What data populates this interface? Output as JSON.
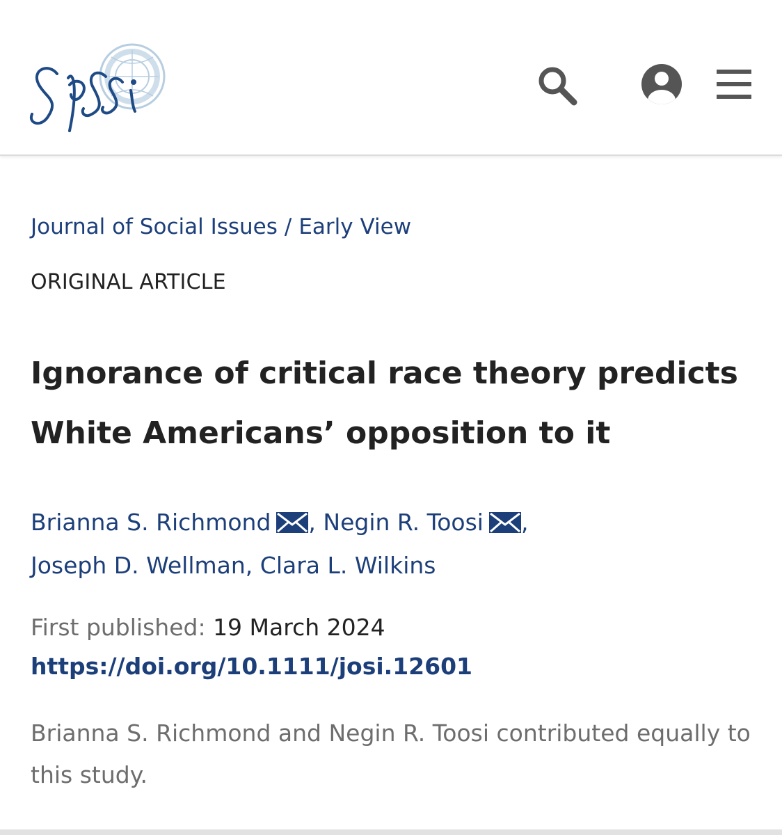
{
  "header": {
    "logo_text": "SPSSI",
    "icons": {
      "search": "search-icon",
      "account": "account-icon",
      "menu": "menu-icon"
    }
  },
  "breadcrumb": {
    "journal": "Journal of Social Issues",
    "separator": "/",
    "section": "Early View"
  },
  "article_type": "ORIGINAL ARTICLE",
  "title": "Ignorance of critical race theory predicts White Americans’ opposition to it",
  "authors": [
    {
      "name": "Brianna S. Richmond",
      "has_email": true
    },
    {
      "name": "Negin R. Toosi",
      "has_email": true
    },
    {
      "name": "Joseph D. Wellman",
      "has_email": false
    },
    {
      "name": "Clara L. Wilkins",
      "has_email": false
    }
  ],
  "author_separator": ",",
  "published": {
    "label": "First published:",
    "date": "19 March 2024"
  },
  "doi": "https://doi.org/10.1111/josi.12601",
  "note": "Brianna S. Richmond and Negin R. Toosi contributed equally to this study.",
  "colors": {
    "link": "#1c3f7a",
    "muted": "#6d6d6d",
    "text": "#222222",
    "icon": "#555555"
  }
}
